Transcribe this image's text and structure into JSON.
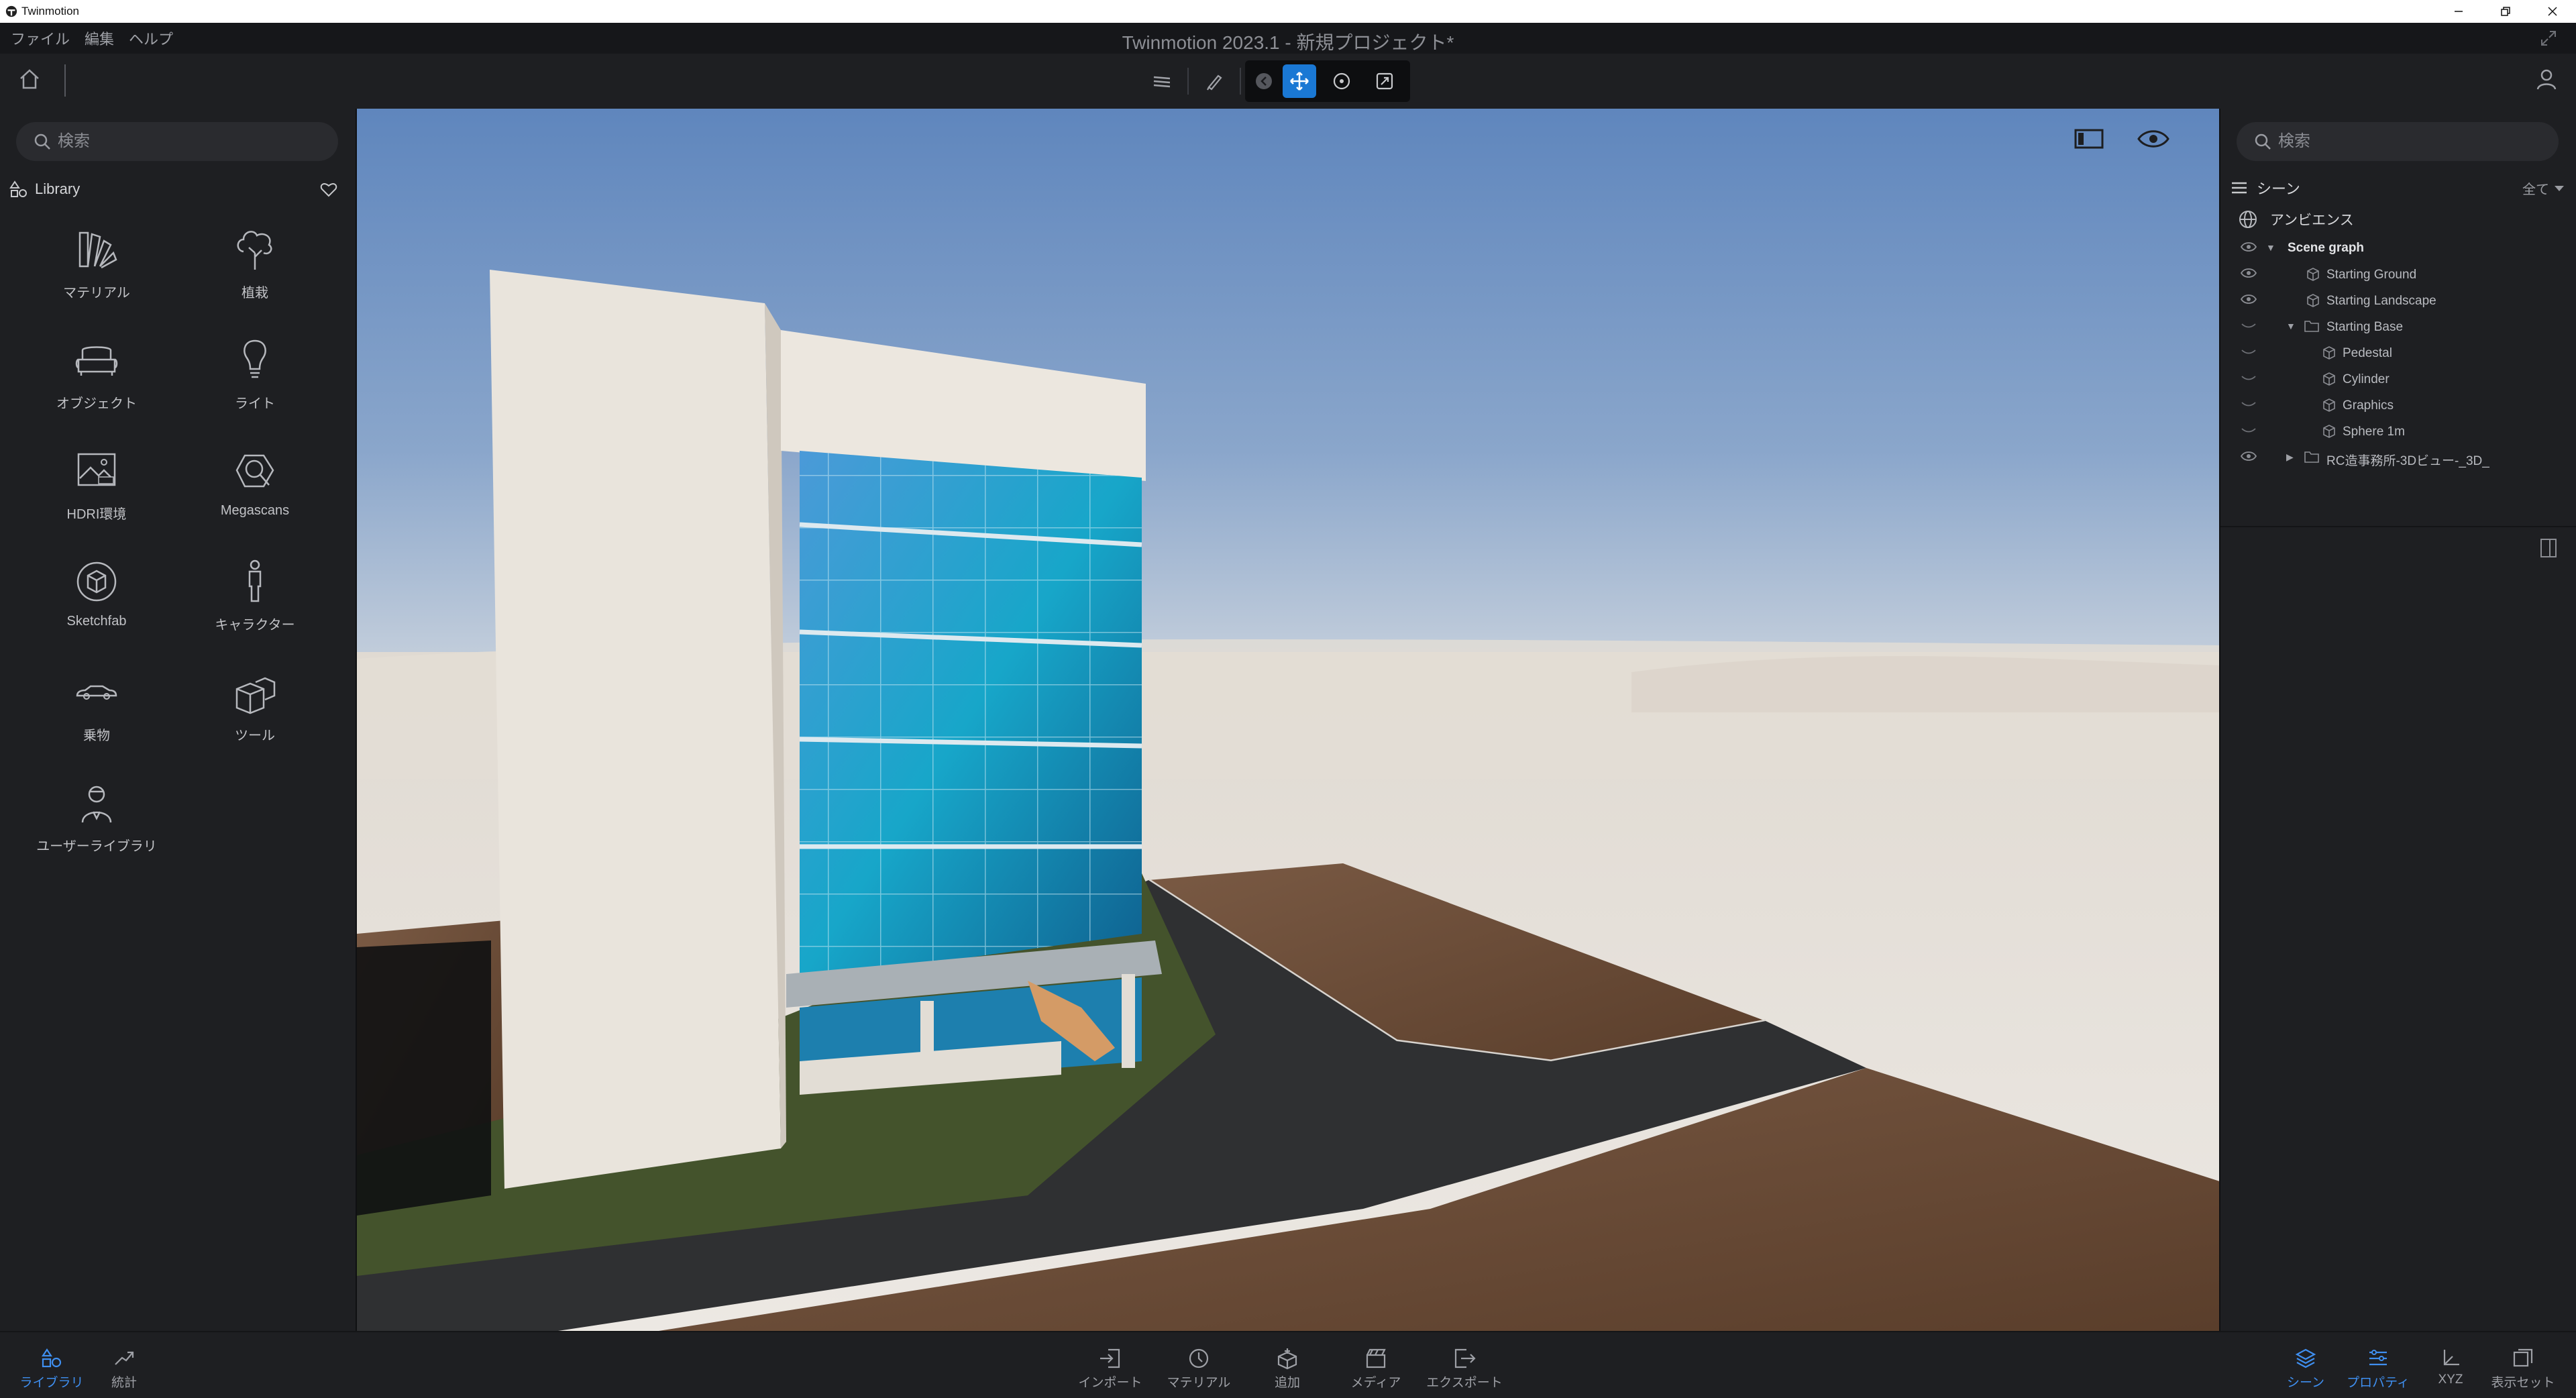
{
  "os_window": {
    "title": "Twinmotion"
  },
  "menu": {
    "items": [
      "ファイル",
      "編集",
      "ヘルプ"
    ]
  },
  "app_title": "Twinmotion 2023.1 - 新規プロジェクト*",
  "left_panel": {
    "search_placeholder": "検索",
    "library_title": "Library",
    "items": [
      {
        "label": "マテリアル",
        "icon": "material-swatch-icon"
      },
      {
        "label": "植栽",
        "icon": "tree-icon"
      },
      {
        "label": "オブジェクト",
        "icon": "sofa-icon"
      },
      {
        "label": "ライト",
        "icon": "lightbulb-icon"
      },
      {
        "label": "HDRI環境",
        "icon": "hdri-image-icon"
      },
      {
        "label": "Megascans",
        "icon": "megascans-icon"
      },
      {
        "label": "Sketchfab",
        "icon": "sketchfab-icon"
      },
      {
        "label": "キャラクター",
        "icon": "character-icon"
      },
      {
        "label": "乗物",
        "icon": "car-icon"
      },
      {
        "label": "ツール",
        "icon": "tool-cubes-icon"
      },
      {
        "label": "ユーザーライブラリ",
        "icon": "user-library-icon"
      }
    ]
  },
  "right_panel": {
    "search_placeholder": "検索",
    "scene_title": "シーン",
    "filter_label": "全て",
    "ambience_label": "アンビエンス",
    "tree": [
      {
        "label": "Scene graph",
        "level": 0,
        "expand": "▼",
        "visible": true,
        "bold": true
      },
      {
        "label": "Starting Ground",
        "level": 1,
        "expand": "",
        "visible": true,
        "bold": false
      },
      {
        "label": "Starting Landscape",
        "level": 1,
        "expand": "",
        "visible": true,
        "bold": false
      },
      {
        "label": "Starting Base",
        "level": 1,
        "expand": "▼",
        "visible": false,
        "bold": false,
        "folder": true
      },
      {
        "label": "Pedestal",
        "level": 2,
        "expand": "",
        "visible": false,
        "bold": false
      },
      {
        "label": "Cylinder",
        "level": 2,
        "expand": "",
        "visible": false,
        "bold": false
      },
      {
        "label": "Graphics",
        "level": 2,
        "expand": "",
        "visible": false,
        "bold": false
      },
      {
        "label": "Sphere 1m",
        "level": 2,
        "expand": "",
        "visible": false,
        "bold": false
      },
      {
        "label": "RC造事務所-3Dビュー-_3D_",
        "level": 1,
        "expand": "▶",
        "visible": true,
        "bold": false,
        "folder": true
      }
    ]
  },
  "bottom_bar": {
    "left": [
      {
        "label": "ライブラリ",
        "icon": "library-icon",
        "active": true
      },
      {
        "label": "統計",
        "icon": "stats-icon",
        "active": false
      }
    ],
    "center": [
      {
        "label": "インポート",
        "icon": "import-icon"
      },
      {
        "label": "マテリアル",
        "icon": "material-picker-icon"
      },
      {
        "label": "追加",
        "icon": "add-icon"
      },
      {
        "label": "メディア",
        "icon": "media-icon"
      },
      {
        "label": "エクスポート",
        "icon": "export-icon"
      }
    ],
    "right": [
      {
        "label": "シーン",
        "icon": "scene-layers-icon",
        "active": true
      },
      {
        "label": "プロパティ",
        "icon": "properties-icon",
        "active": true
      },
      {
        "label": "XYZ",
        "icon": "xyz-icon",
        "active": false
      },
      {
        "label": "表示セット",
        "icon": "display-set-icon",
        "active": false
      }
    ]
  },
  "colors": {
    "accent": "#1a78d4",
    "panel": "#1e1f22",
    "sky": "#6d91c2"
  }
}
